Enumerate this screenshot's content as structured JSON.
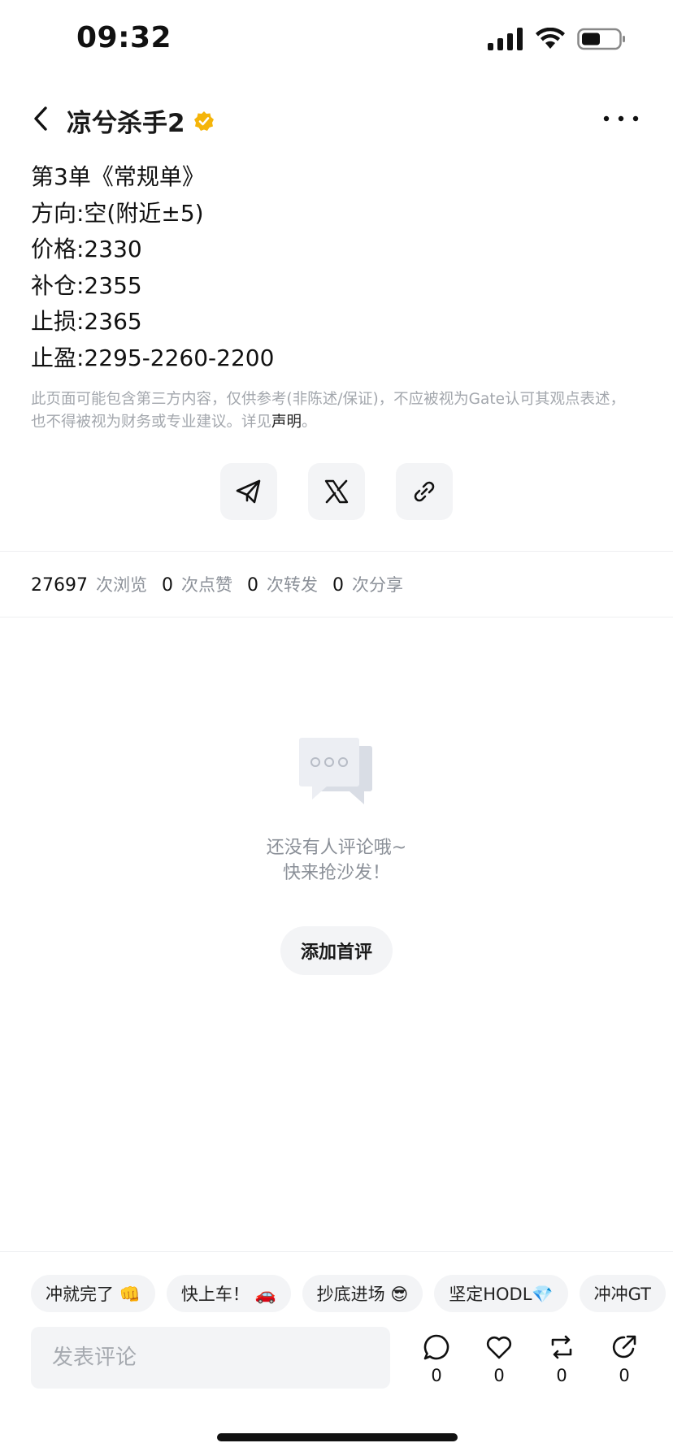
{
  "status_bar": {
    "time": "09:32"
  },
  "header": {
    "author": "凉兮杀手2",
    "icons": [
      "back-icon",
      "verified-icon",
      "more-icon"
    ]
  },
  "post": {
    "lines": [
      "第3单《常规单》",
      "方向:空(附近±5)",
      "价格:2330",
      "补仓:2355",
      "止损:2365",
      "止盈:2295-2260-2200"
    ]
  },
  "disclaimer": {
    "text": "此页面可能包含第三方内容，仅供参考(非陈述/保证)，不应被视为Gate认可其观点表述，也不得被视为财务或专业建议。详见",
    "link": "声明",
    "suffix": "。"
  },
  "share": {
    "icons": [
      "telegram-icon",
      "x-icon",
      "link-icon"
    ]
  },
  "stats": {
    "views": "27697",
    "views_label": "次浏览",
    "likes": "0",
    "likes_label": "次点赞",
    "reposts": "0",
    "reposts_label": "次转发",
    "shares": "0",
    "shares_label": "次分享"
  },
  "empty": {
    "line1": "还没有人评论哦~",
    "line2": "快来抢沙发！",
    "button": "添加首评"
  },
  "bottom": {
    "chips": [
      "冲就完了 👊",
      "快上车！ 🚗",
      "抄底进场 😎",
      "坚定HODL💎",
      "冲冲GT"
    ],
    "input_placeholder": "发表评论",
    "actions": [
      {
        "icon": "comment-icon",
        "count": "0"
      },
      {
        "icon": "heart-icon",
        "count": "0"
      },
      {
        "icon": "repost-icon",
        "count": "0"
      },
      {
        "icon": "share-icon",
        "count": "0"
      }
    ]
  },
  "colors": {
    "accent_verified": "#f5b50a",
    "muted_text": "#8b9098",
    "chip_bg": "#f3f4f6"
  }
}
